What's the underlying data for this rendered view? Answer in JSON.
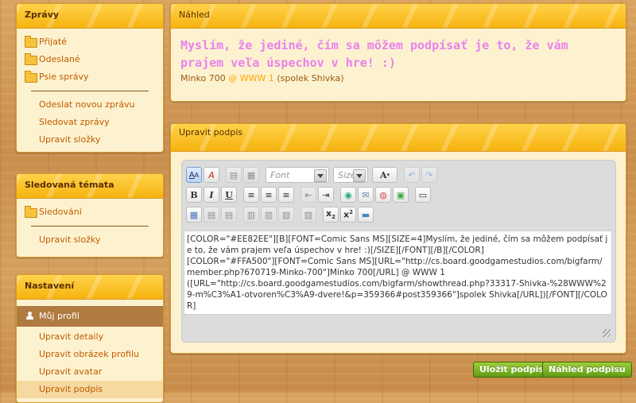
{
  "sidebar": {
    "messages": {
      "title": "Zprávy",
      "folders": [
        "Přijaté",
        "Odeslané",
        "Psie správy"
      ],
      "actions": [
        "Odeslat novou zprávu",
        "Sledovat zprávy",
        "Upravit složky"
      ]
    },
    "watched": {
      "title": "Sledovaná témata",
      "folders": [
        "Sledování"
      ],
      "actions": [
        "Upravit složky"
      ]
    },
    "settings": {
      "title": "Nastavení",
      "profile_label": "Můj profil",
      "actions": [
        "Upravit detaily",
        "Upravit obrázek profilu",
        "Upravit avatar",
        "Upravit podpis"
      ]
    }
  },
  "preview": {
    "title": "Náhled",
    "big_text": "Myslím, že jediné, čím sa môžem podpísať je to, že vám prajem veľa úspechov v hre! :)",
    "author": "Minko 700",
    "sep": " @ ",
    "world": "WWW 1",
    "guild": "(spolek Shivka)",
    "colors": {
      "big": "#EE82EE",
      "link": "#FFA500"
    }
  },
  "edit_signature": {
    "title": "Upravit podpis",
    "font_placeholder": "Font",
    "size_placeholder": "Size",
    "bbcode": "[COLOR=\"#EE82EE\"][B][FONT=Comic Sans MS][SIZE=4]Myslím, že jediné, čím sa môžem podpísať je to, že vám prajem veľa úspechov v hre! :)[/SIZE][/FONT][/B][/COLOR]\n[COLOR=\"#FFA500\"][FONT=Comic Sans MS][URL=\"http://cs.board.goodgamestudios.com/bigfarm/member.php?670719-Minko-700\"]Minko 700[/URL] @ WWW 1\n([URL=\"http://cs.board.goodgamestudios.com/bigfarm/showthread.php?33317-Shivka-%28WWW%29-m%C3%A1-otvoren%C3%A9-dvere!&p=359366#post359366\"]spolek Shivka[/URL])[/FONT][/COLOR]",
    "save_button": "Uložit podpis",
    "preview_button": "Náhled podpisu"
  },
  "toolbar_icons": {
    "row1": [
      "switch-mode-icon",
      "remove-format-icon",
      "copy-icon",
      "paste-icon",
      "font-dropdown",
      "size-dropdown",
      "text-color-icon",
      "undo-icon",
      "redo-icon"
    ],
    "row2": [
      "bold-icon",
      "italic-icon",
      "underline-icon",
      "align-left-icon",
      "align-center-icon",
      "align-right-icon",
      "outdent-icon",
      "indent-icon",
      "link-icon",
      "email-icon",
      "unlink-icon",
      "image-icon",
      "quote-icon"
    ],
    "row3": [
      "table-icon",
      "insert-row-icon",
      "delete-row-icon",
      "insert-col-icon",
      "delete-col-icon",
      "merge-icon",
      "split-icon",
      "subscript-icon",
      "superscript-icon",
      "hr-icon"
    ]
  }
}
